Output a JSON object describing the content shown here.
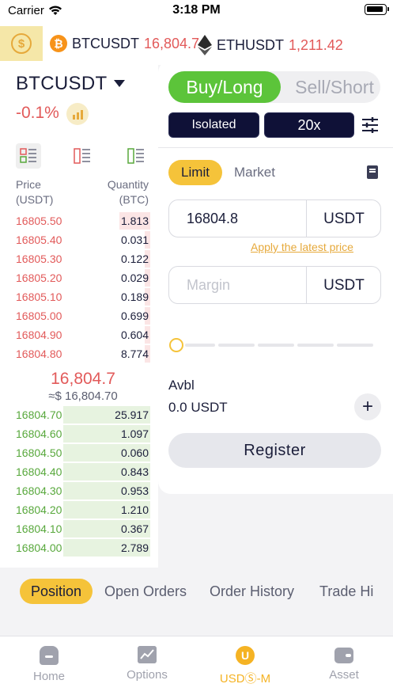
{
  "status_bar": {
    "carrier": "Carrier",
    "time": "3:18 PM"
  },
  "ticker": [
    {
      "symbol": "BTCUSDT",
      "price": "16,804.7",
      "icon": "btc-icon"
    },
    {
      "symbol": "ETHUSDT",
      "price": "1,211.42",
      "icon": "eth-icon"
    }
  ],
  "pair": {
    "name": "BTCUSDT",
    "change": "-0.1%"
  },
  "orderbook": {
    "price_header": [
      "Price",
      "(USDT)"
    ],
    "qty_header": [
      "Quantity",
      "(BTC)"
    ],
    "asks": [
      {
        "price": "16805.50",
        "qty": "1.813",
        "depth": 0.22
      },
      {
        "price": "16805.40",
        "qty": "0.031",
        "depth": 0.04
      },
      {
        "price": "16805.30",
        "qty": "0.122",
        "depth": 0.04
      },
      {
        "price": "16805.20",
        "qty": "0.029",
        "depth": 0.04
      },
      {
        "price": "16805.10",
        "qty": "0.189",
        "depth": 0.04
      },
      {
        "price": "16805.00",
        "qty": "0.699",
        "depth": 0.04
      },
      {
        "price": "16804.90",
        "qty": "0.604",
        "depth": 0.04
      },
      {
        "price": "16804.80",
        "qty": "8.774",
        "depth": 0.04
      }
    ],
    "last_price": "16,804.7",
    "last_price_usd": "≈$ 16,804.70",
    "bids": [
      {
        "price": "16804.70",
        "qty": "25.917",
        "depth": 0.62
      },
      {
        "price": "16804.60",
        "qty": "1.097",
        "depth": 0.62
      },
      {
        "price": "16804.50",
        "qty": "0.060",
        "depth": 0.62
      },
      {
        "price": "16804.40",
        "qty": "0.843",
        "depth": 0.62
      },
      {
        "price": "16804.30",
        "qty": "0.953",
        "depth": 0.62
      },
      {
        "price": "16804.20",
        "qty": "1.210",
        "depth": 0.62
      },
      {
        "price": "16804.10",
        "qty": "0.367",
        "depth": 0.62
      },
      {
        "price": "16804.00",
        "qty": "2.789",
        "depth": 0.62
      }
    ]
  },
  "trade": {
    "buy_label": "Buy/Long",
    "sell_label": "Sell/Short",
    "margin_mode": "Isolated",
    "leverage": "20x",
    "order_types": {
      "limit": "Limit",
      "market": "Market"
    },
    "price_value": "16804.8",
    "price_unit": "USDT",
    "apply_latest": "Apply the latest price",
    "margin_placeholder": "Margin",
    "margin_unit": "USDT",
    "slider_value": 0,
    "avbl_label": "Avbl",
    "avbl_value": "0.0 USDT",
    "plus": "+",
    "register_label": "Register"
  },
  "position_tabs": [
    "Position",
    "Open Orders",
    "Order History",
    "Trade History"
  ],
  "tabbar": [
    {
      "label": "Home",
      "icon": "home-icon"
    },
    {
      "label": "Options",
      "icon": "options-icon"
    },
    {
      "label": "USDⓈ-M",
      "icon": "usdm-icon",
      "active": true
    },
    {
      "label": "Asset",
      "icon": "wallet-icon"
    }
  ],
  "colors": {
    "accent": "#f5c33a",
    "buy": "#5cc43a",
    "ask": "#e25a5a",
    "bid": "#58a83c",
    "navy": "#0f1137"
  }
}
